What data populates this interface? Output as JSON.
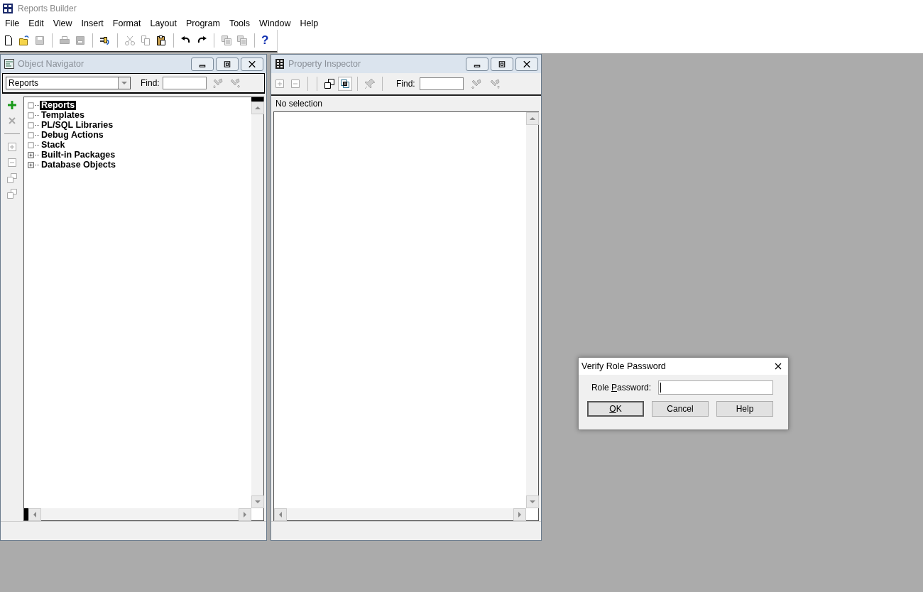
{
  "app": {
    "title": "Reports Builder"
  },
  "menu": [
    "File",
    "Edit",
    "View",
    "Insert",
    "Format",
    "Layout",
    "Program",
    "Tools",
    "Window",
    "Help"
  ],
  "toolbar": [
    {
      "kind": "new",
      "disabled": false
    },
    {
      "kind": "open",
      "disabled": false
    },
    {
      "kind": "save",
      "disabled": true
    },
    {
      "kind": "separator"
    },
    {
      "kind": "print",
      "disabled": true
    },
    {
      "kind": "page-setup",
      "disabled": true
    },
    {
      "kind": "separator"
    },
    {
      "kind": "connect",
      "disabled": false
    },
    {
      "kind": "separator"
    },
    {
      "kind": "cut",
      "disabled": true
    },
    {
      "kind": "copy",
      "disabled": true
    },
    {
      "kind": "paste",
      "disabled": false
    },
    {
      "kind": "separator"
    },
    {
      "kind": "undo",
      "disabled": false
    },
    {
      "kind": "redo",
      "disabled": false
    },
    {
      "kind": "separator"
    },
    {
      "kind": "import",
      "disabled": true
    },
    {
      "kind": "export",
      "disabled": true
    },
    {
      "kind": "separator"
    },
    {
      "kind": "help",
      "disabled": false,
      "glyph": "?"
    }
  ],
  "navigator": {
    "title": "Object Navigator",
    "view_select": "Reports",
    "find_label": "Find:",
    "tools": [
      {
        "kind": "create",
        "disabled": false
      },
      {
        "kind": "delete",
        "disabled": true
      },
      {
        "kind": "separator"
      },
      {
        "kind": "expand",
        "disabled": true
      },
      {
        "kind": "collapse",
        "disabled": true
      },
      {
        "kind": "expand-all",
        "disabled": true
      },
      {
        "kind": "collapse-all",
        "disabled": true
      }
    ],
    "tree": [
      {
        "label": "Reports",
        "selected": true,
        "has_children": false
      },
      {
        "label": "Templates",
        "selected": false,
        "has_children": false
      },
      {
        "label": "PL/SQL Libraries",
        "selected": false,
        "has_children": false
      },
      {
        "label": "Debug Actions",
        "selected": false,
        "has_children": false
      },
      {
        "label": "Stack",
        "selected": false,
        "has_children": false
      },
      {
        "label": "Built-in Packages",
        "selected": false,
        "has_children": true
      },
      {
        "label": "Database Objects",
        "selected": false,
        "has_children": true
      }
    ]
  },
  "inspector": {
    "title": "Property Inspector",
    "find_label": "Find:",
    "status": "No selection",
    "tools": [
      {
        "kind": "expand",
        "disabled": true
      },
      {
        "kind": "collapse",
        "disabled": true
      },
      {
        "kind": "separator"
      },
      {
        "kind": "separator"
      },
      {
        "kind": "union",
        "disabled": false,
        "selected": false
      },
      {
        "kind": "intersection",
        "disabled": false,
        "selected": true
      },
      {
        "kind": "separator"
      },
      {
        "kind": "pin",
        "disabled": true
      },
      {
        "kind": "separator"
      }
    ]
  },
  "dialog": {
    "title": "Verify Role Password",
    "field": {
      "label": {
        "before": "Role ",
        "key": "P",
        "after": "assword:"
      },
      "focused": true
    },
    "buttons": [
      {
        "label": {
          "key": "O",
          "after": "K"
        },
        "default": true
      },
      {
        "label": {
          "before": "Cancel"
        },
        "default": false
      },
      {
        "label": {
          "before": "Help"
        },
        "default": false
      }
    ]
  }
}
